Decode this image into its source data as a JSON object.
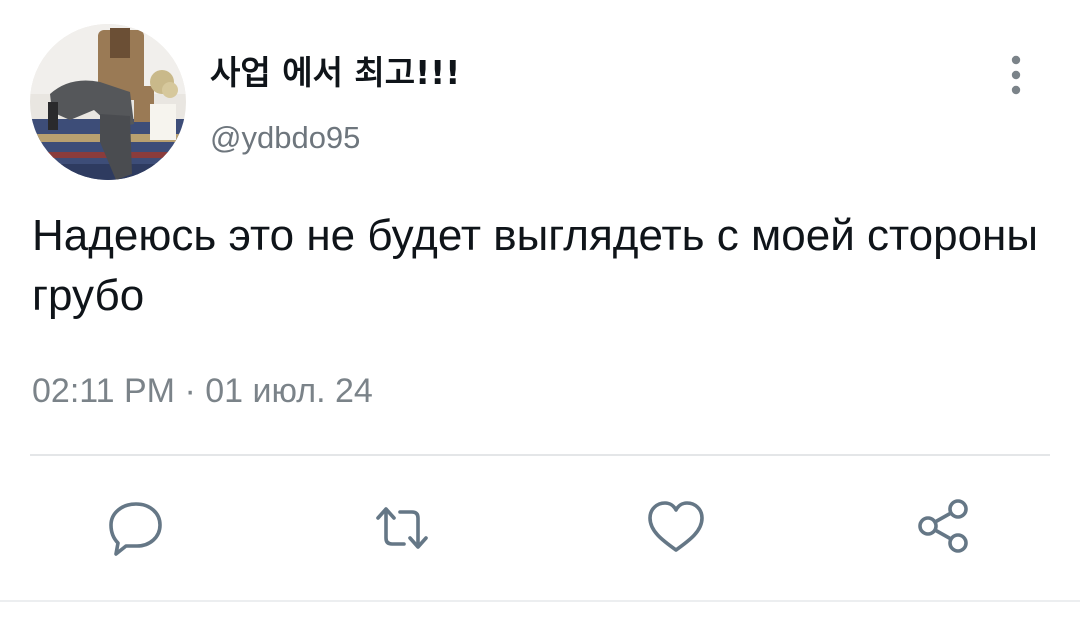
{
  "tweet": {
    "display_name": "사업 에서 최고!!!",
    "handle": "@ydbdo95",
    "text": "Надеюсь это не будет выглядеть с моей стороны грубо",
    "timestamp": "02:11 PM · 01 июл. 24"
  },
  "actions": {
    "reply_icon": "reply-icon",
    "retweet_icon": "retweet-icon",
    "like_icon": "heart-icon",
    "share_icon": "share-icon"
  },
  "colors": {
    "text": "#0f1419",
    "secondary": "#6e767d",
    "icon": "#657786",
    "divider": "#e4e6e8"
  }
}
